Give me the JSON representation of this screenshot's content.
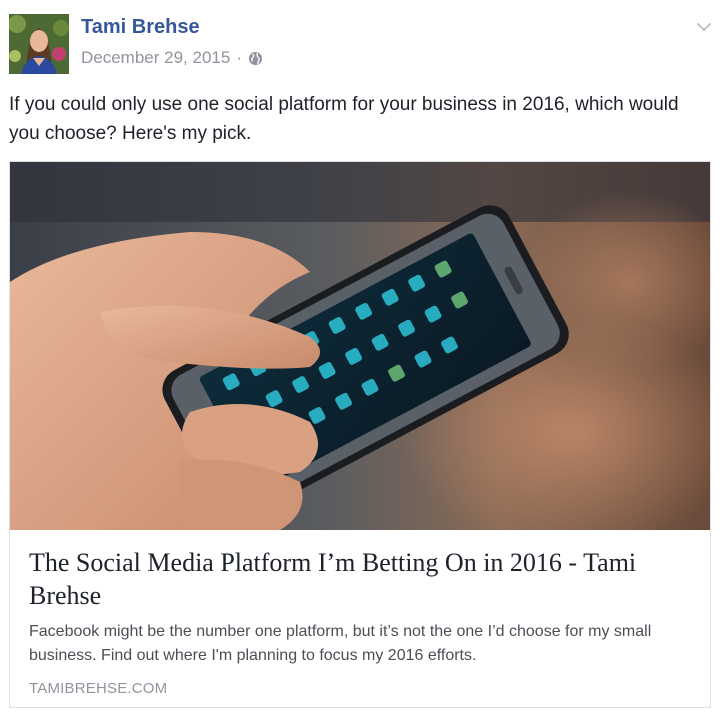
{
  "post": {
    "author": "Tami Brehse",
    "date": "December 29, 2015",
    "separator": "·",
    "privacy_icon": "globe-icon",
    "options_icon": "chevron-down-icon",
    "text": "If you could only use one social platform for your business in 2016, which would you choose? Here's my pick."
  },
  "link_card": {
    "image_icon": "smartphone-photo",
    "title": "The Social Media Platform I’m Betting On in 2016 - Tami Brehse",
    "description": "Facebook might be the number one platform, but it’s not the one I’d choose for my small business. Find out where I'm planning to focus my 2016 efforts.",
    "domain": "TAMIBREHSE.COM"
  },
  "colors": {
    "author_link": "#365899",
    "meta_gray": "#90949c",
    "body_text": "#1d2129",
    "card_border": "#dddfe2"
  }
}
